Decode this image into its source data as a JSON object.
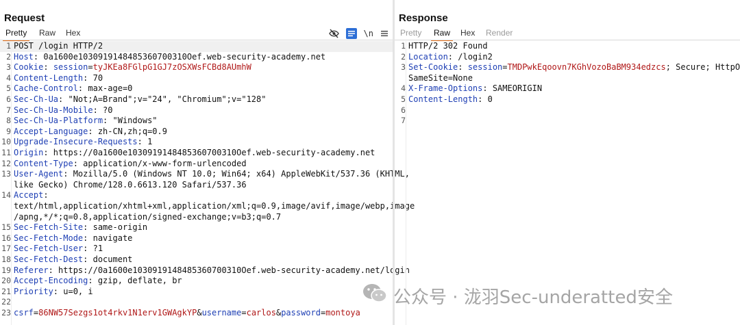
{
  "request": {
    "title": "Request",
    "tabs": [
      {
        "label": "Pretty",
        "active": true
      },
      {
        "label": "Raw",
        "active": false
      },
      {
        "label": "Hex",
        "active": false
      }
    ],
    "tools": {
      "hide_icon": "eye-slash-icon",
      "wrap_icon": "list-wrap-icon",
      "newline_label": "\\n",
      "menu_icon": "menu-icon"
    },
    "lines": [
      {
        "n": "1",
        "parts": [
          {
            "t": "POST /login HTTP/2",
            "c": "val"
          }
        ],
        "hl": true
      },
      {
        "n": "2",
        "parts": [
          {
            "t": "Host",
            "c": "key"
          },
          {
            "t": ": 0a1600e1030919148485360700310Oef.web-security-academy.net",
            "c": "val"
          }
        ]
      },
      {
        "n": "3",
        "parts": [
          {
            "t": "Cookie",
            "c": "key"
          },
          {
            "t": ": ",
            "c": "val"
          },
          {
            "t": "session",
            "c": "key"
          },
          {
            "t": "=",
            "c": "val"
          },
          {
            "t": "tyJKEa8FGlpG1GJ7zOSXWsFCBd8AUmhW",
            "c": "red"
          }
        ]
      },
      {
        "n": "4",
        "parts": [
          {
            "t": "Content-Length",
            "c": "key"
          },
          {
            "t": ": 70",
            "c": "val"
          }
        ]
      },
      {
        "n": "5",
        "parts": [
          {
            "t": "Cache-Control",
            "c": "key"
          },
          {
            "t": ": max-age=0",
            "c": "val"
          }
        ]
      },
      {
        "n": "6",
        "parts": [
          {
            "t": "Sec-Ch-Ua",
            "c": "key"
          },
          {
            "t": ": \"Not;A=Brand\";v=\"24\", \"Chromium\";v=\"128\"",
            "c": "val"
          }
        ]
      },
      {
        "n": "7",
        "parts": [
          {
            "t": "Sec-Ch-Ua-Mobile",
            "c": "key"
          },
          {
            "t": ": ?0",
            "c": "val"
          }
        ]
      },
      {
        "n": "8",
        "parts": [
          {
            "t": "Sec-Ch-Ua-Platform",
            "c": "key"
          },
          {
            "t": ": \"Windows\"",
            "c": "val"
          }
        ]
      },
      {
        "n": "9",
        "parts": [
          {
            "t": "Accept-Language",
            "c": "key"
          },
          {
            "t": ": zh-CN,zh;q=0.9",
            "c": "val"
          }
        ]
      },
      {
        "n": "10",
        "parts": [
          {
            "t": "Upgrade-Insecure-Requests",
            "c": "key"
          },
          {
            "t": ": 1",
            "c": "val"
          }
        ]
      },
      {
        "n": "11",
        "parts": [
          {
            "t": "Origin",
            "c": "key"
          },
          {
            "t": ": https://0a1600e1030919148485360700310Oef.web-security-academy.net",
            "c": "val"
          }
        ]
      },
      {
        "n": "12",
        "parts": [
          {
            "t": "Content-Type",
            "c": "key"
          },
          {
            "t": ": application/x-www-form-urlencoded",
            "c": "val"
          }
        ]
      },
      {
        "n": "13",
        "parts": [
          {
            "t": "User-Agent",
            "c": "key"
          },
          {
            "t": ": Mozilla/5.0 (Windows NT 10.0; Win64; x64) AppleWebKit/537.36 (KHTML,",
            "c": "val"
          }
        ]
      },
      {
        "n": "",
        "parts": [
          {
            "t": "like Gecko) Chrome/128.0.6613.120 Safari/537.36",
            "c": "val"
          }
        ]
      },
      {
        "n": "14",
        "parts": [
          {
            "t": "Accept",
            "c": "key"
          },
          {
            "t": ":",
            "c": "val"
          }
        ]
      },
      {
        "n": "",
        "parts": [
          {
            "t": "text/html,application/xhtml+xml,application/xml;q=0.9,image/avif,image/webp,image",
            "c": "val"
          }
        ]
      },
      {
        "n": "",
        "parts": [
          {
            "t": "/apng,*/*;q=0.8,application/signed-exchange;v=b3;q=0.7",
            "c": "val"
          }
        ]
      },
      {
        "n": "15",
        "parts": [
          {
            "t": "Sec-Fetch-Site",
            "c": "key"
          },
          {
            "t": ": same-origin",
            "c": "val"
          }
        ]
      },
      {
        "n": "16",
        "parts": [
          {
            "t": "Sec-Fetch-Mode",
            "c": "key"
          },
          {
            "t": ": navigate",
            "c": "val"
          }
        ]
      },
      {
        "n": "17",
        "parts": [
          {
            "t": "Sec-Fetch-User",
            "c": "key"
          },
          {
            "t": ": ?1",
            "c": "val"
          }
        ]
      },
      {
        "n": "18",
        "parts": [
          {
            "t": "Sec-Fetch-Dest",
            "c": "key"
          },
          {
            "t": ": document",
            "c": "val"
          }
        ]
      },
      {
        "n": "19",
        "parts": [
          {
            "t": "Referer",
            "c": "key"
          },
          {
            "t": ": https://0a1600e1030919148485360700310Oef.web-security-academy.net/login",
            "c": "val"
          }
        ]
      },
      {
        "n": "20",
        "parts": [
          {
            "t": "Accept-Encoding",
            "c": "key"
          },
          {
            "t": ": gzip, deflate, br",
            "c": "val"
          }
        ]
      },
      {
        "n": "21",
        "parts": [
          {
            "t": "Priority",
            "c": "key"
          },
          {
            "t": ": u=0, i",
            "c": "val"
          }
        ]
      },
      {
        "n": "22",
        "parts": []
      },
      {
        "n": "23",
        "parts": [
          {
            "t": "csrf",
            "c": "key"
          },
          {
            "t": "=",
            "c": "val"
          },
          {
            "t": "86NW57Sezgs1ot4rkv1N1erv1GWAgkYP",
            "c": "red"
          },
          {
            "t": "&",
            "c": "val"
          },
          {
            "t": "username",
            "c": "key"
          },
          {
            "t": "=",
            "c": "val"
          },
          {
            "t": "carlos",
            "c": "red"
          },
          {
            "t": "&",
            "c": "val"
          },
          {
            "t": "password",
            "c": "key"
          },
          {
            "t": "=",
            "c": "val"
          },
          {
            "t": "montoya",
            "c": "red"
          }
        ]
      }
    ]
  },
  "response": {
    "title": "Response",
    "tabs": [
      {
        "label": "Pretty",
        "active": false,
        "disabled": true
      },
      {
        "label": "Raw",
        "active": true
      },
      {
        "label": "Hex",
        "active": false
      },
      {
        "label": "Render",
        "active": false,
        "disabled": true
      }
    ],
    "lines": [
      {
        "n": "1",
        "parts": [
          {
            "t": "HTTP/2 302 Found",
            "c": "val"
          }
        ]
      },
      {
        "n": "2",
        "parts": [
          {
            "t": "Location",
            "c": "key"
          },
          {
            "t": ": /login2",
            "c": "val"
          }
        ]
      },
      {
        "n": "3",
        "parts": [
          {
            "t": "Set-Cookie",
            "c": "key"
          },
          {
            "t": ": ",
            "c": "val"
          },
          {
            "t": "session",
            "c": "key"
          },
          {
            "t": "=",
            "c": "val"
          },
          {
            "t": "TMDPwkEqoovn7KGhVozoBaBM934edzcs",
            "c": "red"
          },
          {
            "t": "; Secure; HttpOnly;",
            "c": "val"
          }
        ]
      },
      {
        "n": "",
        "parts": [
          {
            "t": "SameSite=None",
            "c": "val"
          }
        ]
      },
      {
        "n": "4",
        "parts": [
          {
            "t": "X-Frame-Options",
            "c": "key"
          },
          {
            "t": ": SAMEORIGIN",
            "c": "val"
          }
        ]
      },
      {
        "n": "5",
        "parts": [
          {
            "t": "Content-Length",
            "c": "key"
          },
          {
            "t": ": 0",
            "c": "val"
          }
        ]
      },
      {
        "n": "6",
        "parts": []
      },
      {
        "n": "7",
        "parts": []
      }
    ]
  },
  "watermark": {
    "icon": "wechat-icon",
    "text": "公众号 · 泷羽Sec-underatted安全"
  }
}
